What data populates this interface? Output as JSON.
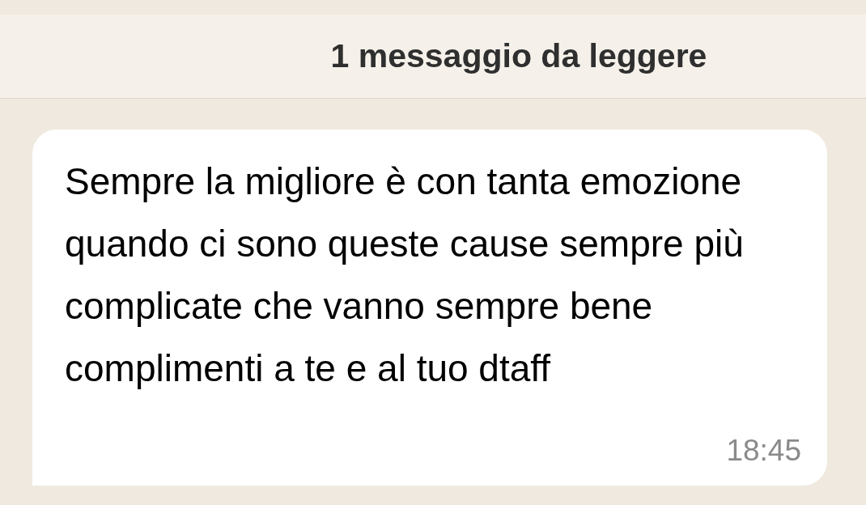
{
  "unread_banner": {
    "text": "1 messaggio da leggere"
  },
  "messages": [
    {
      "kind": "incoming",
      "text": "Sempre la migliore è con tanta emozione quando ci sono queste cause sempre più complicate che vanno sempre bene complimenti a te e al tuo dtaff",
      "time": "18:45"
    }
  ]
}
